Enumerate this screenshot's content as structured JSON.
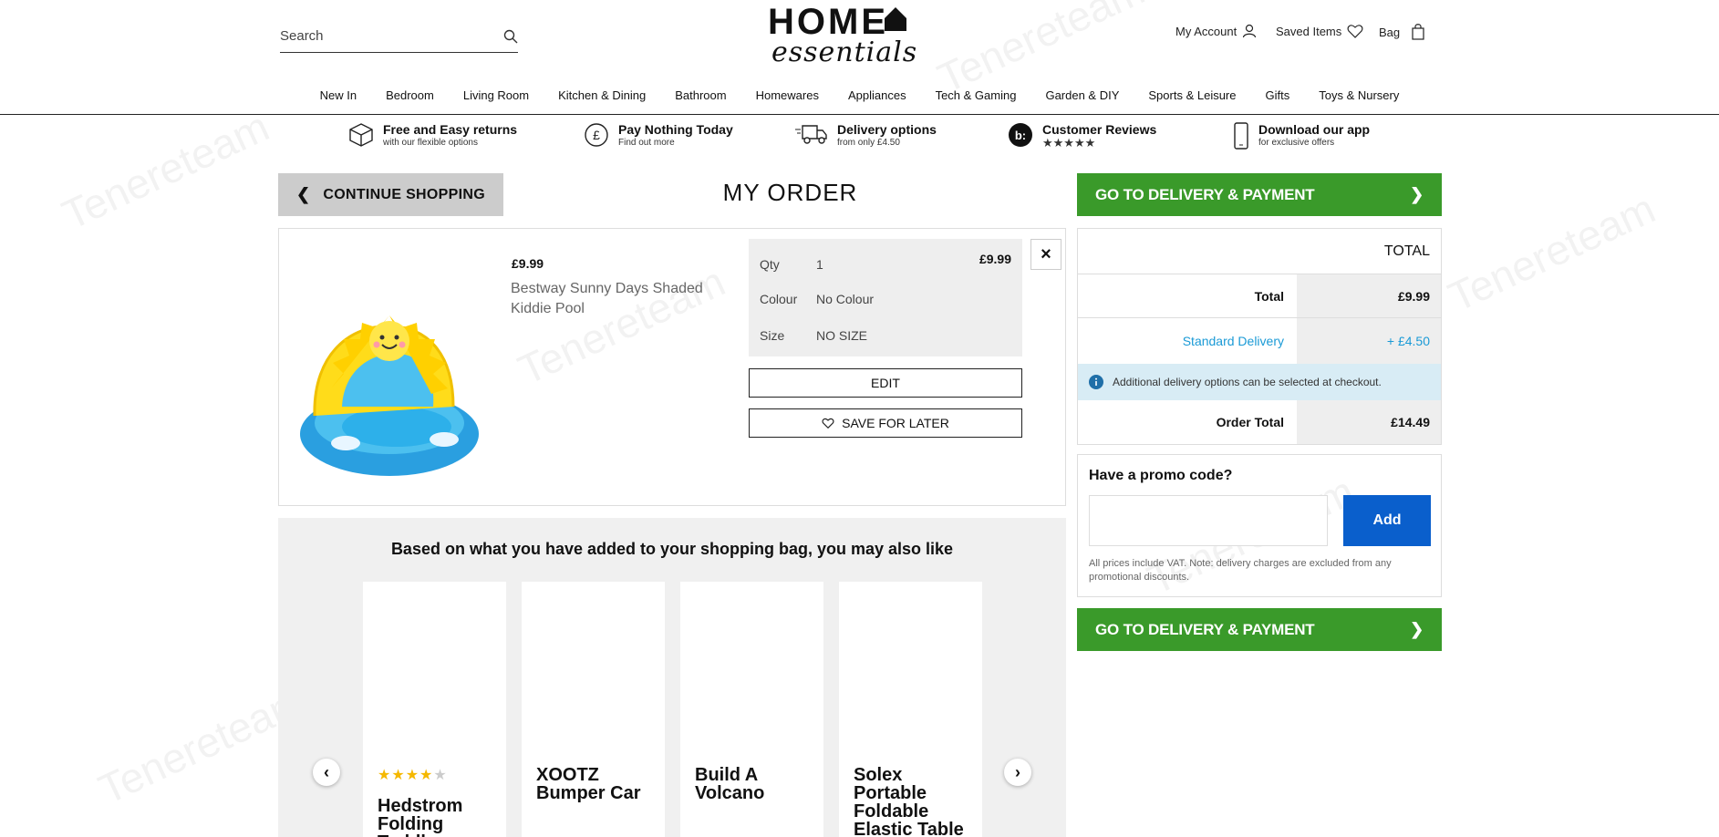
{
  "header": {
    "search_placeholder": "Search",
    "logo_top": "HOME",
    "logo_bottom": "essentials",
    "my_account": "My Account",
    "saved_items": "Saved Items",
    "bag": "Bag"
  },
  "nav": [
    "New In",
    "Bedroom",
    "Living Room",
    "Kitchen & Dining",
    "Bathroom",
    "Homewares",
    "Appliances",
    "Tech & Gaming",
    "Garden & DIY",
    "Sports & Leisure",
    "Gifts",
    "Toys & Nursery"
  ],
  "usps": [
    {
      "title": "Free and Easy returns",
      "sub": "with our flexible options",
      "icon": "box-icon"
    },
    {
      "title": "Pay Nothing Today",
      "sub": "Find out more",
      "icon": "pound-icon"
    },
    {
      "title": "Delivery options",
      "sub": "from only £4.50",
      "icon": "truck-icon"
    },
    {
      "title": "Customer Reviews",
      "sub": "★★★★★",
      "icon": "reviews-icon"
    },
    {
      "title": "Download our app",
      "sub": "for exclusive offers",
      "icon": "phone-icon"
    }
  ],
  "order": {
    "continue_label": "CONTINUE SHOPPING",
    "title": "MY ORDER",
    "item": {
      "price": "£9.99",
      "name": "Bestway Sunny Days Shaded Kiddie Pool",
      "qty_label": "Qty",
      "qty": "1",
      "line_price": "£9.99",
      "colour_label": "Colour",
      "colour": "No Colour",
      "size_label": "Size",
      "size": "NO SIZE",
      "edit_label": "EDIT",
      "save_label": "SAVE FOR LATER",
      "remove": "×"
    }
  },
  "recs": {
    "title": "Based on what you have added to your shopping bag, you may also like",
    "items": [
      {
        "name": "Hedstrom Folding Toddler",
        "rating": 4
      },
      {
        "name": "XOOTZ Bumper Car"
      },
      {
        "name": "Build A Volcano"
      },
      {
        "name": "Solex Portable Foldable Elastic Table"
      }
    ],
    "prev": "‹",
    "next": "›"
  },
  "summary": {
    "go_label": "GO TO DELIVERY & PAYMENT",
    "total_header": "TOTAL",
    "total_label": "Total",
    "total": "£9.99",
    "delivery_label": "Standard Delivery",
    "delivery": "+ £4.50",
    "info": "Additional delivery options can be selected at checkout.",
    "order_total_label": "Order Total",
    "order_total": "£14.49",
    "delivery_color": "#1a9ad6"
  },
  "promo": {
    "heading": "Have a promo code?",
    "add_label": "Add",
    "note": "All prices include VAT. Note: delivery charges are excluded from any promotional discounts."
  },
  "watermark": "Tenereteam"
}
